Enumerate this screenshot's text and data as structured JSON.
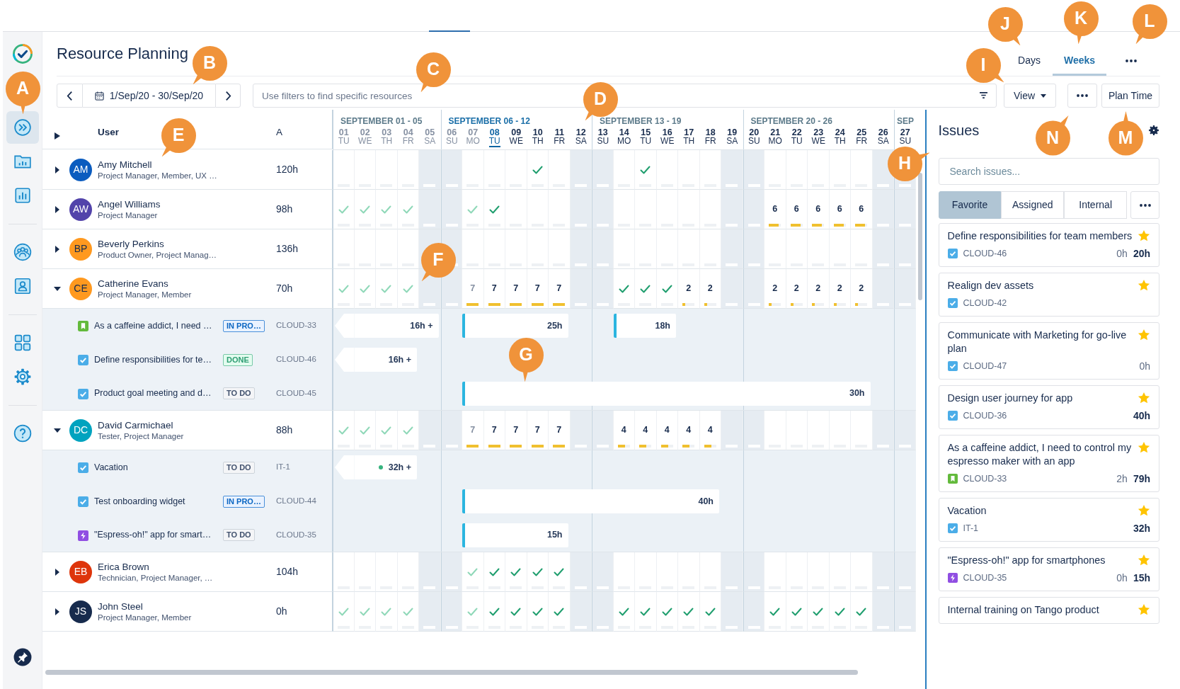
{
  "sidebar": {
    "items": [
      {
        "kind": "logo",
        "selected": false
      },
      {
        "kind": "planner",
        "selected": true
      },
      {
        "kind": "folder",
        "selected": false
      },
      {
        "kind": "reports",
        "selected": false
      },
      {
        "kind": "team",
        "selected": false
      },
      {
        "kind": "profile",
        "selected": false
      },
      {
        "kind": "apps",
        "selected": false
      },
      {
        "kind": "settings",
        "selected": false
      },
      {
        "kind": "help",
        "selected": false
      },
      {
        "kind": "pin",
        "selected": false
      }
    ]
  },
  "header": {
    "title": "Resource Planning",
    "view_tabs": [
      {
        "label": "Days",
        "selected": false
      },
      {
        "label": "Weeks",
        "selected": true
      }
    ]
  },
  "toolbar": {
    "date_range": "1/Sep/20 - 30/Sep/20",
    "filter_placeholder": "Use filters to find specific resources",
    "view_button": "View",
    "plan_button": "Plan Time"
  },
  "planner": {
    "columns": [
      "User",
      "A"
    ],
    "weeks": [
      {
        "label": "SEPTEMBER 01 - 05",
        "current": false,
        "days": [
          {
            "num": "01",
            "dow": "TU",
            "past": true,
            "today": false,
            "weekend": false
          },
          {
            "num": "02",
            "dow": "WE",
            "past": true,
            "today": false,
            "weekend": false
          },
          {
            "num": "03",
            "dow": "TH",
            "past": true,
            "today": false,
            "weekend": false
          },
          {
            "num": "04",
            "dow": "FR",
            "past": true,
            "today": false,
            "weekend": false
          },
          {
            "num": "05",
            "dow": "SA",
            "past": true,
            "today": false,
            "weekend": true
          }
        ]
      },
      {
        "label": "SEPTEMBER 06 - 12",
        "current": true,
        "days": [
          {
            "num": "06",
            "dow": "SU",
            "past": true,
            "today": false,
            "weekend": true
          },
          {
            "num": "07",
            "dow": "MO",
            "past": true,
            "today": false,
            "weekend": false
          },
          {
            "num": "08",
            "dow": "TU",
            "past": false,
            "today": true,
            "weekend": false
          },
          {
            "num": "09",
            "dow": "WE",
            "past": false,
            "today": false,
            "weekend": false
          },
          {
            "num": "10",
            "dow": "TH",
            "past": false,
            "today": false,
            "weekend": false
          },
          {
            "num": "11",
            "dow": "FR",
            "past": false,
            "today": false,
            "weekend": false
          },
          {
            "num": "12",
            "dow": "SA",
            "past": false,
            "today": false,
            "weekend": true
          }
        ]
      },
      {
        "label": "SEPTEMBER 13 - 19",
        "current": false,
        "days": [
          {
            "num": "13",
            "dow": "SU",
            "past": false,
            "today": false,
            "weekend": true
          },
          {
            "num": "14",
            "dow": "MO",
            "past": false,
            "today": false,
            "weekend": false
          },
          {
            "num": "15",
            "dow": "TU",
            "past": false,
            "today": false,
            "weekend": false
          },
          {
            "num": "16",
            "dow": "WE",
            "past": false,
            "today": false,
            "weekend": false
          },
          {
            "num": "17",
            "dow": "TH",
            "past": false,
            "today": false,
            "weekend": false
          },
          {
            "num": "18",
            "dow": "FR",
            "past": false,
            "today": false,
            "weekend": false
          },
          {
            "num": "19",
            "dow": "SA",
            "past": false,
            "today": false,
            "weekend": true
          }
        ]
      },
      {
        "label": "SEPTEMBER 20 - 26",
        "current": false,
        "days": [
          {
            "num": "20",
            "dow": "SU",
            "past": false,
            "today": false,
            "weekend": true
          },
          {
            "num": "21",
            "dow": "MO",
            "past": false,
            "today": false,
            "weekend": false
          },
          {
            "num": "22",
            "dow": "TU",
            "past": false,
            "today": false,
            "weekend": false
          },
          {
            "num": "23",
            "dow": "WE",
            "past": false,
            "today": false,
            "weekend": false
          },
          {
            "num": "24",
            "dow": "TH",
            "past": false,
            "today": false,
            "weekend": false
          },
          {
            "num": "25",
            "dow": "FR",
            "past": false,
            "today": false,
            "weekend": false
          },
          {
            "num": "26",
            "dow": "SA",
            "past": false,
            "today": false,
            "weekend": true
          }
        ]
      },
      {
        "label": "SEP",
        "current": false,
        "days": [
          {
            "num": "27",
            "dow": "SU",
            "past": false,
            "today": false,
            "weekend": true
          }
        ]
      }
    ],
    "rows": [
      {
        "initials": "AM",
        "name": "Amy Mitchell",
        "roles": "Project Manager, Member, UX …",
        "hours": "120h",
        "color": "#0b5cbf",
        "expanded": false,
        "cells": [
          null,
          null,
          null,
          null,
          null,
          null,
          null,
          null,
          null,
          {
            "kind": "check"
          },
          null,
          null,
          null,
          null,
          {
            "kind": "check"
          }
        ]
      },
      {
        "initials": "AW",
        "name": "Angel Williams",
        "roles": "Project Manager",
        "hours": "98h",
        "color": "#5243aa",
        "expanded": false,
        "cells": [
          {
            "kind": "check"
          },
          {
            "kind": "check"
          },
          {
            "kind": "check"
          },
          {
            "kind": "check"
          },
          null,
          null,
          {
            "kind": "check"
          },
          {
            "kind": "check"
          },
          null,
          null,
          null,
          null,
          null,
          null,
          null,
          null,
          null,
          null,
          null,
          null,
          {
            "kind": "hours",
            "text": "6",
            "level": 0.85
          },
          {
            "kind": "hours",
            "text": "6",
            "level": 0.85
          },
          {
            "kind": "hours",
            "text": "6",
            "level": 0.85
          },
          {
            "kind": "hours",
            "text": "6",
            "level": 0.85
          },
          {
            "kind": "hours",
            "text": "6",
            "level": 0.85
          }
        ]
      },
      {
        "initials": "BP",
        "name": "Beverly Perkins",
        "roles": "Product Owner, Project Manag…",
        "hours": "136h",
        "color": "#ff991f",
        "expanded": false
      },
      {
        "initials": "CE",
        "name": "Catherine Evans",
        "roles": "Project Manager, Member",
        "hours": "70h",
        "color": "#ff991f",
        "expanded": true,
        "cells": [
          {
            "kind": "check"
          },
          {
            "kind": "check"
          },
          {
            "kind": "check"
          },
          {
            "kind": "check"
          },
          null,
          null,
          {
            "kind": "hours",
            "text": "7",
            "level": 1
          },
          {
            "kind": "hours",
            "text": "7",
            "level": 1
          },
          {
            "kind": "hours",
            "text": "7",
            "level": 1
          },
          {
            "kind": "hours",
            "text": "7",
            "level": 1
          },
          {
            "kind": "hours",
            "text": "7",
            "level": 1
          },
          null,
          null,
          {
            "kind": "check"
          },
          {
            "kind": "check"
          },
          {
            "kind": "check"
          },
          {
            "kind": "hours",
            "text": "2",
            "level": 0.25
          },
          {
            "kind": "hours",
            "text": "2",
            "level": 0.25
          },
          null,
          null,
          {
            "kind": "hours",
            "text": "2",
            "level": 0.25
          },
          {
            "kind": "hours",
            "text": "2",
            "level": 0.25
          },
          {
            "kind": "hours",
            "text": "2",
            "level": 0.25
          },
          {
            "kind": "hours",
            "text": "2",
            "level": 0.25
          },
          {
            "kind": "hours",
            "text": "2",
            "level": 0.25
          }
        ],
        "children": [
          {
            "kind": "story",
            "title": "As a caffeine addict, I need …",
            "status": {
              "label": "IN PRO…",
              "kind": "in_progress"
            },
            "key": "CLOUD-33",
            "booked": [
              true,
              true,
              true,
              true,
              true,
              false,
              true,
              true,
              true,
              true,
              true,
              false,
              false,
              true,
              true,
              true
            ],
            "bars": [
              {
                "label": "16h +",
                "overflow": true
              },
              {
                "label": "25h",
                "overflow": false
              },
              {
                "label": "18h",
                "overflow": false
              }
            ]
          },
          {
            "kind": "task",
            "title": "Define responsibilities for te…",
            "status": {
              "label": "DONE",
              "kind": "done"
            },
            "key": "CLOUD-46",
            "booked": [
              true,
              true,
              true,
              true
            ],
            "bars": [
              {
                "label": "16h +",
                "overflow": true
              }
            ]
          },
          {
            "kind": "task",
            "title": "Product goal meeting and d…",
            "status": {
              "label": "TO DO",
              "kind": "todo"
            },
            "key": "CLOUD-45",
            "booked": [
              false,
              false,
              false,
              false,
              false,
              false,
              true,
              true,
              true,
              true,
              true,
              true,
              true,
              true,
              true,
              true,
              true,
              true,
              true,
              true,
              true,
              true,
              true,
              true,
              true
            ],
            "bars": [
              {
                "label": "30h",
                "overflow": false
              }
            ]
          }
        ]
      },
      {
        "initials": "DC",
        "name": "David Carmichael",
        "roles": "Tester, Project Manager",
        "hours": "88h",
        "color": "#00a3bf",
        "expanded": true,
        "cells": [
          {
            "kind": "check"
          },
          {
            "kind": "check"
          },
          {
            "kind": "check"
          },
          {
            "kind": "check"
          },
          null,
          null,
          {
            "kind": "hours",
            "text": "7",
            "level": 1
          },
          {
            "kind": "hours",
            "text": "7",
            "level": 1
          },
          {
            "kind": "hours",
            "text": "7",
            "level": 1
          },
          {
            "kind": "hours",
            "text": "7",
            "level": 1
          },
          {
            "kind": "hours",
            "text": "7",
            "level": 1
          },
          null,
          null,
          {
            "kind": "hours",
            "text": "4",
            "level": 0.6
          },
          {
            "kind": "hours",
            "text": "4",
            "level": 0.6
          },
          {
            "kind": "hours",
            "text": "4",
            "level": 0.6
          },
          {
            "kind": "hours",
            "text": "4",
            "level": 0.6
          },
          {
            "kind": "hours",
            "text": "4",
            "level": 0.6
          }
        ],
        "children": [
          {
            "kind": "task",
            "title": "Vacation",
            "status": {
              "label": "TO DO",
              "kind": "todo"
            },
            "key": "IT-1",
            "booked": [
              true,
              true,
              true,
              true
            ],
            "bars": [
              {
                "label": "32h +",
                "overflow": true,
                "color": "#36b37e"
              }
            ]
          },
          {
            "kind": "task",
            "title": "Test onboarding widget",
            "status": {
              "label": "IN PRO…",
              "kind": "in_progress"
            },
            "key": "CLOUD-44",
            "booked": [
              false,
              false,
              false,
              false,
              false,
              false,
              true,
              true,
              true,
              true,
              true,
              true,
              true,
              true,
              true,
              true,
              true,
              true
            ],
            "bars": [
              {
                "label": "40h",
                "overflow": false
              }
            ]
          },
          {
            "kind": "epic",
            "title": "\"Espress-oh!\" app for smart…",
            "status": {
              "label": "TO DO",
              "kind": "todo"
            },
            "key": "CLOUD-35",
            "booked": [
              false,
              false,
              false,
              false,
              false,
              false,
              true,
              true,
              true,
              true,
              true
            ],
            "bars": [
              {
                "label": "15h",
                "overflow": false
              }
            ]
          }
        ]
      },
      {
        "initials": "EB",
        "name": "Erica Brown",
        "roles": "Technician, Project Manager, …",
        "hours": "104h",
        "color": "#de350b",
        "expanded": false,
        "cells": [
          null,
          null,
          null,
          null,
          null,
          null,
          {
            "kind": "check"
          },
          {
            "kind": "check"
          },
          {
            "kind": "check"
          },
          {
            "kind": "check"
          },
          {
            "kind": "check"
          }
        ]
      },
      {
        "initials": "JS",
        "name": "John Steel",
        "roles": "Project Manager, Member",
        "hours": "0h",
        "color": "#172b4d",
        "expanded": false,
        "cells": [
          {
            "kind": "check"
          },
          {
            "kind": "check"
          },
          {
            "kind": "check"
          },
          {
            "kind": "check"
          },
          null,
          null,
          {
            "kind": "check"
          },
          {
            "kind": "check"
          },
          {
            "kind": "check"
          },
          {
            "kind": "check"
          },
          {
            "kind": "check"
          },
          null,
          null,
          {
            "kind": "check"
          },
          {
            "kind": "check"
          },
          {
            "kind": "check"
          },
          {
            "kind": "check"
          },
          {
            "kind": "check"
          },
          null,
          null,
          {
            "kind": "check"
          },
          {
            "kind": "check"
          },
          {
            "kind": "check"
          },
          {
            "kind": "check"
          },
          {
            "kind": "check"
          }
        ]
      }
    ]
  },
  "issues_panel": {
    "title": "Issues",
    "search_placeholder": "Search issues...",
    "tabs": [
      {
        "label": "Favorite",
        "selected": true
      },
      {
        "label": "Assigned",
        "selected": false
      },
      {
        "label": "Internal",
        "selected": false
      }
    ],
    "cards": [
      {
        "title": "Define responsibilities for team members",
        "kind": "task",
        "key": "CLOUD-46",
        "spent": "0h",
        "estimate": "20h",
        "starred": true
      },
      {
        "title": "Realign dev assets",
        "kind": "task",
        "key": "CLOUD-42",
        "starred": true
      },
      {
        "title": "Communicate with Marketing for go-live plan",
        "kind": "task",
        "key": "CLOUD-47",
        "spent": "0h",
        "starred": true
      },
      {
        "title": "Design user journey for app",
        "kind": "task",
        "key": "CLOUD-36",
        "estimate": "40h",
        "starred": true
      },
      {
        "title": "As a caffeine addict, I need to control my espresso maker with an app",
        "kind": "story",
        "key": "CLOUD-33",
        "spent": "2h",
        "estimate": "79h",
        "starred": true
      },
      {
        "title": "Vacation",
        "kind": "task",
        "key": "IT-1",
        "estimate": "32h",
        "starred": true
      },
      {
        "title": "\"Espress-oh!\" app for smartphones",
        "kind": "epic",
        "key": "CLOUD-35",
        "spent": "0h",
        "estimate": "15h",
        "starred": true
      },
      {
        "title": "Internal training on Tango product",
        "starred": true
      }
    ]
  },
  "callouts": [
    {
      "label": "A"
    },
    {
      "label": "B"
    },
    {
      "label": "C"
    },
    {
      "label": "D"
    },
    {
      "label": "E"
    },
    {
      "label": "F"
    },
    {
      "label": "G"
    },
    {
      "label": "H"
    },
    {
      "label": "I"
    },
    {
      "label": "J"
    },
    {
      "label": "K"
    },
    {
      "label": "L"
    },
    {
      "label": "N"
    },
    {
      "label": "M"
    }
  ]
}
